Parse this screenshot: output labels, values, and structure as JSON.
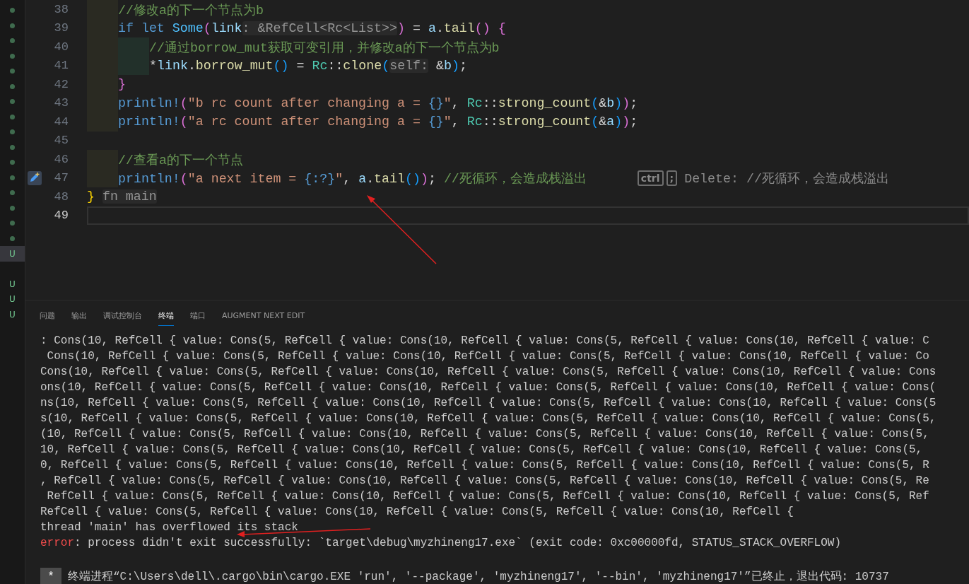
{
  "activity_marks": [
    {
      "kind": "dot"
    },
    {
      "kind": "dot"
    },
    {
      "kind": "dot"
    },
    {
      "kind": "dot"
    },
    {
      "kind": "dot"
    },
    {
      "kind": "dot"
    },
    {
      "kind": "dot"
    },
    {
      "kind": "dot"
    },
    {
      "kind": "dot"
    },
    {
      "kind": "dot"
    },
    {
      "kind": "dot"
    },
    {
      "kind": "dot"
    },
    {
      "kind": "dot"
    },
    {
      "kind": "dot"
    },
    {
      "kind": "dot"
    },
    {
      "kind": "dot"
    },
    {
      "kind": "letter",
      "text": "U",
      "selected": true
    },
    {
      "kind": "gap"
    },
    {
      "kind": "letter",
      "text": "U",
      "selected": false
    },
    {
      "kind": "letter",
      "text": "U",
      "selected": false
    },
    {
      "kind": "letter",
      "text": "U",
      "selected": false
    }
  ],
  "editor": {
    "lines": [
      {
        "number": "38",
        "guides": [
          {
            "kind": "outer"
          }
        ],
        "current": false,
        "tokens": [
          {
            "text": "//修改a的下一个节点为b",
            "kind": "comment"
          }
        ]
      },
      {
        "number": "39",
        "guides": [
          {
            "kind": "outer"
          }
        ],
        "current": false,
        "tokens": [
          {
            "text": "if let ",
            "kind": "keyword"
          },
          {
            "text": "Some",
            "kind": "variant"
          },
          {
            "text": "(",
            "kind": "bracket2"
          },
          {
            "text": "link",
            "kind": "variable"
          },
          {
            "text": ": &RefCell<Rc<List>>",
            "kind": "hint"
          },
          {
            "text": ")",
            "kind": "bracket2"
          },
          {
            "text": " = ",
            "kind": "plain"
          },
          {
            "text": "a",
            "kind": "variable"
          },
          {
            "text": ".",
            "kind": "plain"
          },
          {
            "text": "tail",
            "kind": "function"
          },
          {
            "text": "()",
            "kind": "bracket2"
          },
          {
            "text": " {",
            "kind": "bracket2"
          }
        ]
      },
      {
        "number": "40",
        "guides": [
          {
            "kind": "outer"
          },
          {
            "kind": "inner"
          }
        ],
        "current": false,
        "tokens": [
          {
            "text": "//通过borrow_mut获取可变引用，并修改a的下一个节点为b",
            "kind": "comment"
          }
        ]
      },
      {
        "number": "41",
        "guides": [
          {
            "kind": "outer"
          },
          {
            "kind": "inner"
          }
        ],
        "current": false,
        "tokens": [
          {
            "text": "*",
            "kind": "plain"
          },
          {
            "text": "link",
            "kind": "variable"
          },
          {
            "text": ".",
            "kind": "plain"
          },
          {
            "text": "borrow_mut",
            "kind": "function"
          },
          {
            "text": "()",
            "kind": "bracket3"
          },
          {
            "text": " = ",
            "kind": "plain"
          },
          {
            "text": "Rc",
            "kind": "type"
          },
          {
            "text": "::",
            "kind": "plain"
          },
          {
            "text": "clone",
            "kind": "function"
          },
          {
            "text": "(",
            "kind": "bracket3"
          },
          {
            "text": "self:",
            "kind": "hint"
          },
          {
            "text": " &",
            "kind": "plain"
          },
          {
            "text": "b",
            "kind": "variable"
          },
          {
            "text": ")",
            "kind": "bracket3"
          },
          {
            "text": ";",
            "kind": "plain"
          }
        ]
      },
      {
        "number": "42",
        "guides": [
          {
            "kind": "outer"
          }
        ],
        "current": false,
        "tokens": [
          {
            "text": "}",
            "kind": "bracket2"
          }
        ]
      },
      {
        "number": "43",
        "guides": [
          {
            "kind": "outer"
          }
        ],
        "current": false,
        "tokens": [
          {
            "text": "println!",
            "kind": "macro"
          },
          {
            "text": "(",
            "kind": "bracket2"
          },
          {
            "text": "\"b rc count after changing a = ",
            "kind": "string"
          },
          {
            "text": "{}",
            "kind": "format"
          },
          {
            "text": "\"",
            "kind": "string"
          },
          {
            "text": ", ",
            "kind": "plain"
          },
          {
            "text": "Rc",
            "kind": "type"
          },
          {
            "text": "::",
            "kind": "plain"
          },
          {
            "text": "strong_count",
            "kind": "function"
          },
          {
            "text": "(",
            "kind": "bracket3"
          },
          {
            "text": "&",
            "kind": "plain"
          },
          {
            "text": "b",
            "kind": "variable"
          },
          {
            "text": ")",
            "kind": "bracket3"
          },
          {
            "text": ")",
            "kind": "bracket2"
          },
          {
            "text": ";",
            "kind": "plain"
          }
        ]
      },
      {
        "number": "44",
        "guides": [
          {
            "kind": "outer"
          }
        ],
        "current": false,
        "tokens": [
          {
            "text": "println!",
            "kind": "macro"
          },
          {
            "text": "(",
            "kind": "bracket2"
          },
          {
            "text": "\"a rc count after changing a = ",
            "kind": "string"
          },
          {
            "text": "{}",
            "kind": "format"
          },
          {
            "text": "\"",
            "kind": "string"
          },
          {
            "text": ", ",
            "kind": "plain"
          },
          {
            "text": "Rc",
            "kind": "type"
          },
          {
            "text": "::",
            "kind": "plain"
          },
          {
            "text": "strong_count",
            "kind": "function"
          },
          {
            "text": "(",
            "kind": "bracket3"
          },
          {
            "text": "&",
            "kind": "plain"
          },
          {
            "text": "a",
            "kind": "variable"
          },
          {
            "text": ")",
            "kind": "bracket3"
          },
          {
            "text": ")",
            "kind": "bracket2"
          },
          {
            "text": ";",
            "kind": "plain"
          }
        ]
      },
      {
        "number": "45",
        "current": false
      },
      {
        "number": "46",
        "guides": [
          {
            "kind": "outer"
          }
        ],
        "current": false,
        "tokens": [
          {
            "text": "//查看a的下一个节点",
            "kind": "comment"
          }
        ]
      },
      {
        "number": "47",
        "guides": [
          {
            "kind": "outer"
          }
        ],
        "current": false,
        "edit_marker": true,
        "tokens": [
          {
            "text": "println!",
            "kind": "macro"
          },
          {
            "text": "(",
            "kind": "bracket2"
          },
          {
            "text": "\"a next item = ",
            "kind": "string"
          },
          {
            "text": "{:?}",
            "kind": "format"
          },
          {
            "text": "\"",
            "kind": "string"
          },
          {
            "text": ", ",
            "kind": "plain"
          },
          {
            "text": "a",
            "kind": "variable"
          },
          {
            "text": ".",
            "kind": "plain"
          },
          {
            "text": "tail",
            "kind": "function"
          },
          {
            "text": "()",
            "kind": "bracket3"
          },
          {
            "text": ")",
            "kind": "bracket2"
          },
          {
            "text": "; ",
            "kind": "plain"
          },
          {
            "text": "//死循环，会造成栈溢出",
            "kind": "comment"
          }
        ],
        "suggestion": {
          "keys": [
            "ctrl",
            ";"
          ],
          "text": "Delete: //死循环，会造成栈溢出"
        }
      },
      {
        "number": "48",
        "current": false,
        "tokens": [
          {
            "text": "} ",
            "kind": "bracket1"
          },
          {
            "text": "fn main",
            "kind": "hint"
          }
        ]
      },
      {
        "number": "49",
        "current": true
      }
    ]
  },
  "panel": {
    "tabs": [
      {
        "label": "问题",
        "selected": false
      },
      {
        "label": "输出",
        "selected": false
      },
      {
        "label": "调试控制台",
        "selected": false
      },
      {
        "label": "终端",
        "selected": true
      },
      {
        "label": "端口",
        "selected": false
      },
      {
        "label": "AUGMENT NEXT EDIT",
        "selected": false
      }
    ],
    "terminal_lines": [
      {
        "kind": "output",
        "text": ": Cons(10, RefCell { value: Cons(5, RefCell { value: Cons(10, RefCell { value: Cons(5, RefCell { value: Cons(10, RefCell { value: C"
      },
      {
        "kind": "output",
        "text": " Cons(10, RefCell { value: Cons(5, RefCell { value: Cons(10, RefCell { value: Cons(5, RefCell { value: Cons(10, RefCell { value: Co"
      },
      {
        "kind": "output",
        "text": "Cons(10, RefCell { value: Cons(5, RefCell { value: Cons(10, RefCell { value: Cons(5, RefCell { value: Cons(10, RefCell { value: Cons"
      },
      {
        "kind": "output",
        "text": "ons(10, RefCell { value: Cons(5, RefCell { value: Cons(10, RefCell { value: Cons(5, RefCell { value: Cons(10, RefCell { value: Cons("
      },
      {
        "kind": "output",
        "text": "ns(10, RefCell { value: Cons(5, RefCell { value: Cons(10, RefCell { value: Cons(5, RefCell { value: Cons(10, RefCell { value: Cons(5"
      },
      {
        "kind": "output",
        "text": "s(10, RefCell { value: Cons(5, RefCell { value: Cons(10, RefCell { value: Cons(5, RefCell { value: Cons(10, RefCell { value: Cons(5,"
      },
      {
        "kind": "output",
        "text": "(10, RefCell { value: Cons(5, RefCell { value: Cons(10, RefCell { value: Cons(5, RefCell { value: Cons(10, RefCell { value: Cons(5,"
      },
      {
        "kind": "output",
        "text": "10, RefCell { value: Cons(5, RefCell { value: Cons(10, RefCell { value: Cons(5, RefCell { value: Cons(10, RefCell { value: Cons(5,"
      },
      {
        "kind": "output",
        "text": "0, RefCell { value: Cons(5, RefCell { value: Cons(10, RefCell { value: Cons(5, RefCell { value: Cons(10, RefCell { value: Cons(5, R"
      },
      {
        "kind": "output",
        "text": ", RefCell { value: Cons(5, RefCell { value: Cons(10, RefCell { value: Cons(5, RefCell { value: Cons(10, RefCell { value: Cons(5, Re"
      },
      {
        "kind": "output",
        "text": " RefCell { value: Cons(5, RefCell { value: Cons(10, RefCell { value: Cons(5, RefCell { value: Cons(10, RefCell { value: Cons(5, Ref"
      },
      {
        "kind": "output",
        "text": "RefCell { value: Cons(5, RefCell { value: Cons(10, RefCell { value: Cons(5, RefCell { value: Cons(10, RefCell {"
      },
      {
        "kind": "output",
        "text": "thread 'main' has overflowed its stack"
      },
      {
        "kind": "error",
        "label": "error",
        "text": ": process didn't exit successfully: `target\\debug\\myzhineng17.exe` (exit code: 0xc00000fd, STATUS_STACK_OVERFLOW)"
      },
      {
        "kind": "blank"
      },
      {
        "kind": "notice",
        "marker": "*",
        "text": "终端进程“C:\\Users\\dell\\.cargo\\bin\\cargo.EXE 'run', '--package', 'myzhineng17', '--bin', 'myzhineng17'”已终止，退出代码: 10737"
      }
    ]
  }
}
